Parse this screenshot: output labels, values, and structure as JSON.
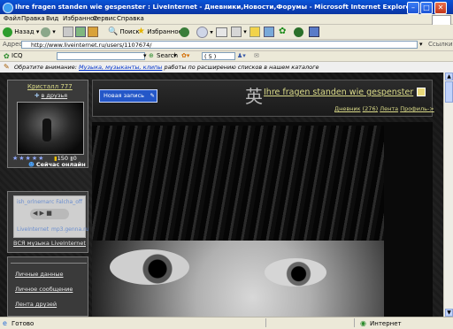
{
  "window": {
    "title": "Ihre fragen standen wie gespenster : LiveInternet - Дневники,Новости,Форумы - Microsoft Internet Explorer"
  },
  "menu": [
    "Файл",
    "Правка",
    "Вид",
    "Избранное",
    "Сервис",
    "Справка"
  ],
  "toolbar": {
    "back": "Назад",
    "search": "Поиск",
    "favorites": "Избранное"
  },
  "address": {
    "label": "Адрес",
    "url": "http://www.liveinternet.ru/users/1107674/",
    "links": "Ссылки"
  },
  "icqbar": {
    "icq": "ICQ",
    "search": "Search",
    "count": "( 5 )"
  },
  "notice": {
    "prefix": "Обратите внимание:",
    "link": "Музыка, музыканты, клипы",
    "suffix": "работы по расширению списков в нашем каталоге"
  },
  "profile": {
    "name": "Кристалл 777",
    "add_friend": "в друзья",
    "rating": "150",
    "rating2": "0",
    "online": "Сейчас онлайн",
    "stars": "★★★★★"
  },
  "music": {
    "user1": "ish_orlnemar",
    "user2": "с Falcha_off",
    "brand1": "LiveInternet",
    "brand2": "mp3.genna.ru",
    "all_music": "ВСЯ музыка LiveInternet"
  },
  "sidebar": [
    "Личные данные",
    "Личное сообщение",
    "Лента друзей"
  ],
  "blog": {
    "new_post": "Новая запись",
    "title": "Ihre fragen standen wie gespenster",
    "diary": "Дневник",
    "count": "(276)",
    "feed": "Лента",
    "profile": "Профиль->"
  },
  "status": {
    "done": "Готово",
    "zone": "Интернет"
  },
  "colors": {
    "title_blue": "#0b45c4",
    "link_yellow": "#dcdc8a",
    "chrome": "#ece9d8"
  }
}
